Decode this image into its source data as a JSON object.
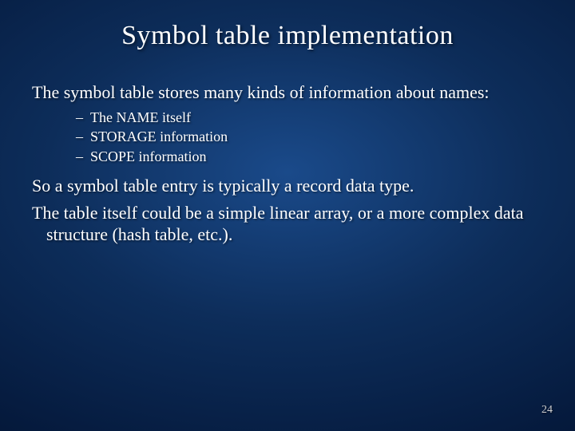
{
  "title": "Symbol table implementation",
  "intro": "The symbol table stores many kinds of information about names:",
  "items": [
    "The NAME itself",
    "STORAGE information",
    "SCOPE information"
  ],
  "closing1": "So a symbol table entry is typically a record data type.",
  "closing2": "The table itself could be a simple linear array, or a more complex data structure (hash table, etc.).",
  "page_number": "24"
}
